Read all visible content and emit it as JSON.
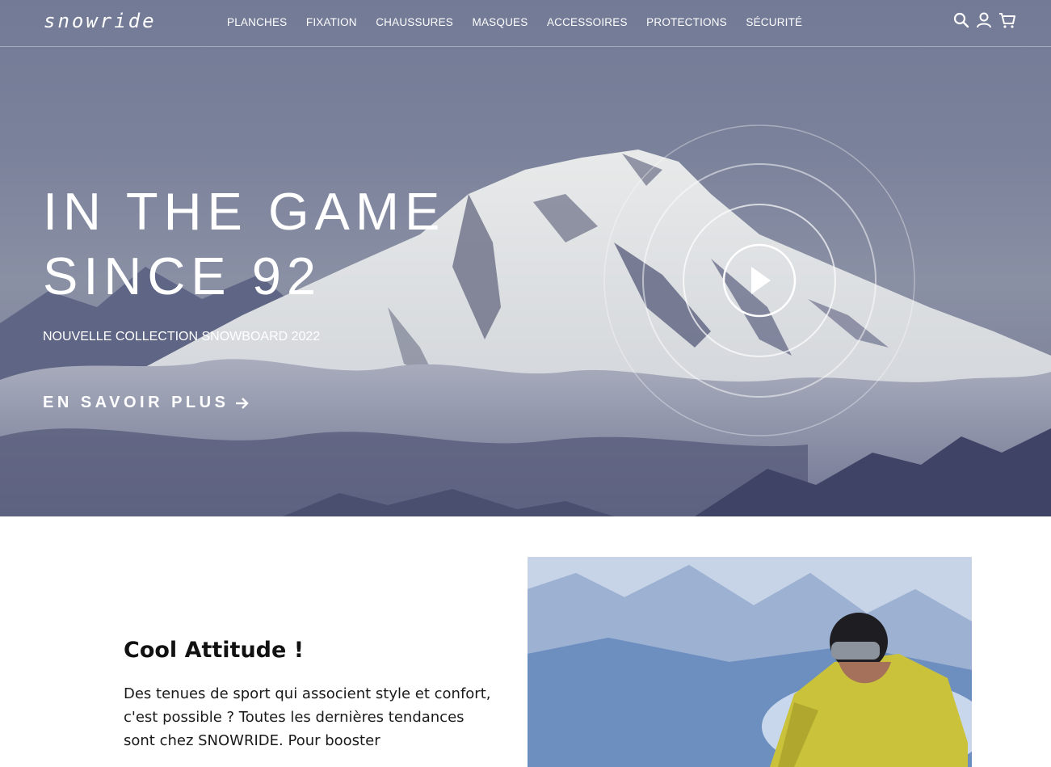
{
  "header": {
    "logo": "snowride",
    "nav": [
      "PLANCHES",
      "FIXATION",
      "CHAUSSURES",
      "MASQUES",
      "ACCESSOIRES",
      "PROTECTIONS",
      "SÉCURITÉ"
    ],
    "icons": [
      "search-icon",
      "user-icon",
      "cart-icon"
    ]
  },
  "hero": {
    "title_line1": "IN THE GAME",
    "title_line2": "SINCE 92",
    "subtitle": "NOUVELLE COLLECTION SNOWBOARD 2022",
    "cta": "EN SAVOIR PLUS",
    "play_icon": "play-icon"
  },
  "section": {
    "title": "Cool Attitude !",
    "text": "Des tenues de sport qui associent style et confort, c'est possible ? Toutes les dernières tendances sont chez SNOWRIDE. Pour booster"
  },
  "colors": {
    "hero_overlay": "#7b829b",
    "text_dark": "#111111",
    "white": "#ffffff"
  }
}
